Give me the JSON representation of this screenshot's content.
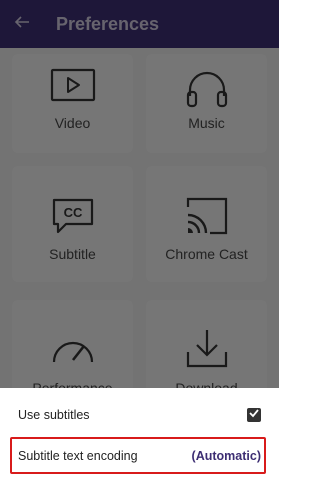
{
  "app_bar": {
    "title": "Preferences",
    "back_icon": "arrow-left-icon"
  },
  "tiles": [
    {
      "label": "Video",
      "icon": "play-video-icon"
    },
    {
      "label": "Music",
      "icon": "headphones-icon"
    },
    {
      "label": "Subtitle",
      "icon": "closed-caption-icon"
    },
    {
      "label": "Chrome Cast",
      "icon": "cast-icon"
    },
    {
      "label": "Performance",
      "icon": "speedometer-icon"
    },
    {
      "label": "Download",
      "icon": "download-icon"
    }
  ],
  "sheet": {
    "use_subtitles_label": "Use subtitles",
    "use_subtitles_checked": true,
    "encoding_label": "Subtitle text encoding",
    "encoding_value": "(Automatic)"
  },
  "colors": {
    "app_bar": "#3d2e73",
    "accent": "#3d2e73",
    "highlight": "#d81b1b"
  }
}
